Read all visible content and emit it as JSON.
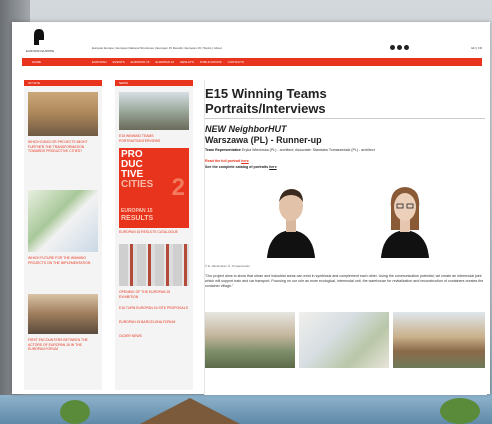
{
  "header": {
    "logo_text": "EUROPAN EUROPE",
    "top_links": "Europan Europe | Europan National Structures | Europan 15 Results | Europan 16 | Topics | About",
    "lang": "EN | FR"
  },
  "nav": {
    "home": "HOME",
    "items": [
      "EUROPAN",
      "EVENTS",
      "EUROPAN 15",
      "EUROPAN 16",
      "RESULTS",
      "PUBLICATIONS",
      "CONTACTS"
    ]
  },
  "sidebar_left": {
    "heading": "ON SITE",
    "items": [
      {
        "caption": "Which ideas or projects might further the transformation towards productive cities?"
      },
      {
        "caption": "Which future for the winning projects on the implementation"
      },
      {
        "caption": "First encounters between the actors of Europan 15 in the Europan Forum"
      }
    ]
  },
  "sidebar_mid": {
    "heading": "NEWS",
    "items": [
      {
        "caption": "E15 Winning Teams Portraits/Interviews"
      },
      {
        "caption": "Europan 15 Results Catalogue"
      },
      {
        "caption": "Opening of the Europan 15 Exhibition"
      },
      {
        "caption": "E16 Turn Europan 16 Site Proposals"
      },
      {
        "caption": "Europan 15 Barcelona Forum"
      },
      {
        "caption": "Older news"
      }
    ],
    "poster": {
      "line1": "PRO",
      "line2": "DUC",
      "line3": "TIVE",
      "line4": "CITIES",
      "big": "2",
      "line5": "EUROPAN 15",
      "line6": "RESULTS"
    }
  },
  "main": {
    "title": "E15 Winning Teams Portraits/Interviews",
    "project": "NEW NeighborHUT",
    "location": "Warszawa (PL) - Runner-up",
    "team_label": "Team Representative",
    "team_text": "Eryka Wieckrska (PL) - architect; Associate: Stanislaw Tomaszewski (PL) - architect",
    "read_prefix": "Read the full portrait",
    "read_link": "here",
    "catalogue_prefix": "See the complete catalog of portraits",
    "catalogue_link": "here",
    "photo_credit": "© E. Wieckrska / S. Tomaszewski",
    "quote": "\"Our project aims to show that urban and industrial areas can exist in symbiosis and complement each other. Using the communication potential, we create an intermodal joint which will support train and car transport. Focusing on our role as more ecological, intermodal unit, the warehouse for revitalization and reconstruction of containers creates the container village.\""
  },
  "colors": {
    "accent": "#e8341c",
    "text": "#222222"
  }
}
